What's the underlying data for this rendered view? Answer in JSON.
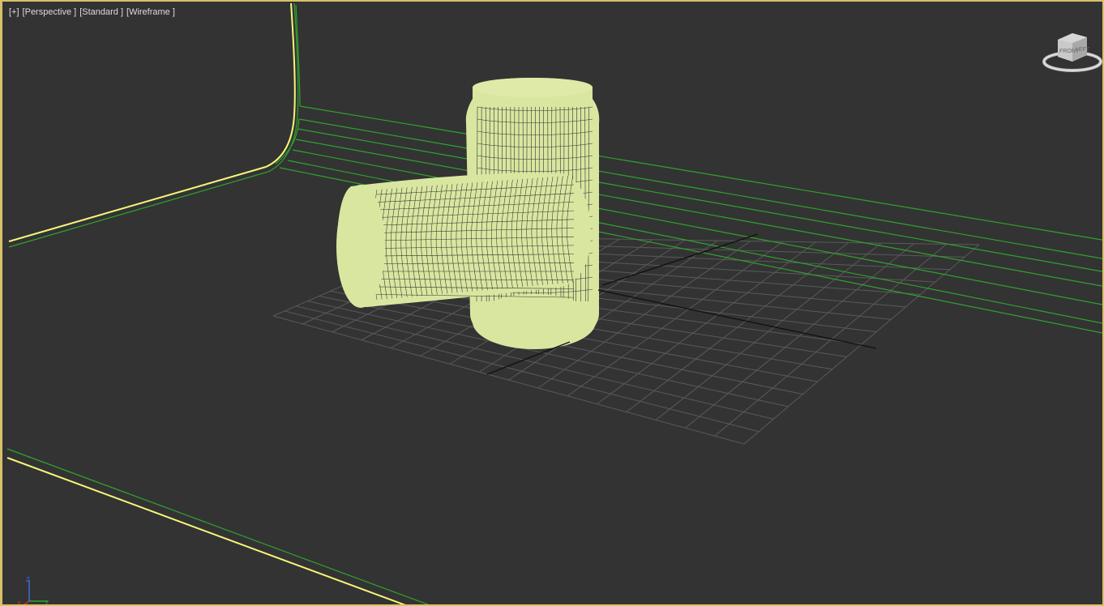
{
  "viewport": {
    "label_plus": "[+]",
    "label_view": "[Perspective ]",
    "label_shading_style": "[Standard ]",
    "label_render_mode": "[Wireframe ]"
  },
  "viewcube": {
    "face_front": "FRONT",
    "face_side": "LEFT",
    "icon": "viewcube-icon"
  },
  "axis_tripod": {
    "z": "Z",
    "x": "X",
    "y": "Y"
  },
  "colors": {
    "background": "#333333",
    "border_active": "#d8c06a",
    "selection_yellow": "#f5f57a",
    "wire_green": "#2fa32f",
    "object_wire": "#d9e6a0",
    "grid": "#5a5a5a",
    "grid_axis": "#111111"
  }
}
